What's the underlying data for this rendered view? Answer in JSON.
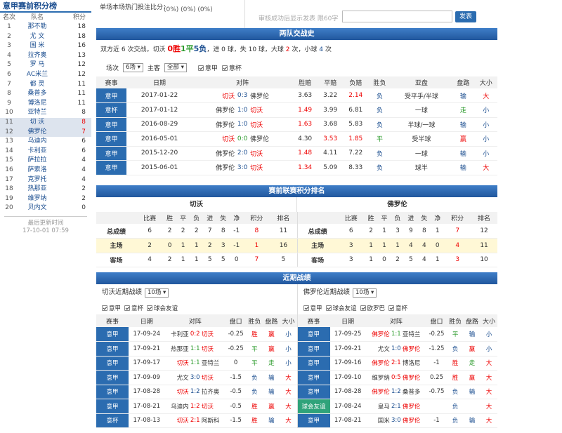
{
  "sidebar": {
    "title": "意甲赛前积分榜",
    "headers": [
      "名次",
      "队名",
      "积分"
    ],
    "rows": [
      {
        "rank": "1",
        "team": "那不勒",
        "pts": "18",
        "hl": false
      },
      {
        "rank": "2",
        "team": "尤 文",
        "pts": "18",
        "hl": false
      },
      {
        "rank": "3",
        "team": "国 米",
        "pts": "16",
        "hl": false
      },
      {
        "rank": "4",
        "team": "拉齐奥",
        "pts": "13",
        "hl": false
      },
      {
        "rank": "5",
        "team": "罗 马",
        "pts": "12",
        "hl": false
      },
      {
        "rank": "6",
        "team": "AC米兰",
        "pts": "12",
        "hl": false
      },
      {
        "rank": "7",
        "team": "都 灵",
        "pts": "11",
        "hl": false
      },
      {
        "rank": "8",
        "team": "桑普多",
        "pts": "11",
        "hl": false
      },
      {
        "rank": "9",
        "team": "博洛尼",
        "pts": "11",
        "hl": false
      },
      {
        "rank": "10",
        "team": "亚特兰",
        "pts": "8",
        "hl": false
      },
      {
        "rank": "11",
        "team": "切 沃",
        "pts": "8",
        "hl": true
      },
      {
        "rank": "12",
        "team": "佛罗伦",
        "pts": "7",
        "hl": true
      },
      {
        "rank": "13",
        "team": "乌迪内",
        "pts": "6",
        "hl": false
      },
      {
        "rank": "14",
        "team": "卡利亚",
        "pts": "6",
        "hl": false
      },
      {
        "rank": "15",
        "team": "萨拉拉",
        "pts": "4",
        "hl": false
      },
      {
        "rank": "16",
        "team": "萨索洛",
        "pts": "4",
        "hl": false
      },
      {
        "rank": "17",
        "team": "克罗托",
        "pts": "4",
        "hl": false
      },
      {
        "rank": "18",
        "team": "热那亚",
        "pts": "2",
        "hl": false
      },
      {
        "rank": "19",
        "team": "维罗纳",
        "pts": "2",
        "hl": false
      },
      {
        "rank": "20",
        "team": "贝内文",
        "pts": "0",
        "hl": false
      }
    ],
    "footer_label": "最后更新时间",
    "footer_time": "17-10-01 07:59"
  },
  "top": {
    "hot_label": "单场本场热门投注比分：",
    "hot_values": "(0%)  (0%)  (0%)",
    "post_hint": "审核成功后显示发表  限60字",
    "post_button": "发表"
  },
  "h2h": {
    "title": "两队交战史",
    "summary_pre": "双方近 6 次交战，切沃 ",
    "summary_w": "0胜",
    "summary_d": "1平",
    "summary_l": "5负",
    "summary_post": "，进 0 球，失 10 球，大球 ",
    "big": "2",
    "summary_mid": " 次，小球 ",
    "small": "4",
    "summary_end": " 次",
    "filter_label": "场次",
    "filter_value": "6场 ▾",
    "host_label": "主客",
    "host_value": "全部 ▾",
    "chk1": "意甲",
    "chk2": "意杯",
    "headers": [
      "赛事",
      "日期",
      "对阵",
      "胜赔",
      "平赔",
      "负赔",
      "胜负",
      "亚盘",
      "盘路",
      "大小"
    ],
    "rows": [
      {
        "league": "意甲",
        "date": "2017-01-22",
        "home": "切沃",
        "score": "0:3",
        "away": "佛罗伦",
        "w": "3.63",
        "d": "3.22",
        "l": "2.14",
        "res": "负",
        "handicap": "受平手/半球",
        "hr": "输",
        "ou": "大"
      },
      {
        "league": "意杯",
        "date": "2017-01-12",
        "home": "佛罗伦",
        "score": "1:0",
        "away": "切沃",
        "w": "1.49",
        "d": "3.99",
        "l": "6.81",
        "res": "负",
        "handicap": "一球",
        "hr": "走",
        "ou": "小"
      },
      {
        "league": "意甲",
        "date": "2016-08-29",
        "home": "佛罗伦",
        "score": "1:0",
        "away": "切沃",
        "w": "1.63",
        "d": "3.68",
        "l": "5.83",
        "res": "负",
        "handicap": "半球/一球",
        "hr": "输",
        "ou": "小"
      },
      {
        "league": "意甲",
        "date": "2016-05-01",
        "home": "切沃",
        "score": "0:0",
        "away": "佛罗伦",
        "w": "4.30",
        "d": "3.53",
        "l": "1.85",
        "res": "平",
        "handicap": "受半球",
        "hr": "赢",
        "ou": "小"
      },
      {
        "league": "意甲",
        "date": "2015-12-20",
        "home": "佛罗伦",
        "score": "2:0",
        "away": "切沃",
        "w": "1.48",
        "d": "4.11",
        "l": "7.22",
        "res": "负",
        "handicap": "一球",
        "hr": "输",
        "ou": "小"
      },
      {
        "league": "意甲",
        "date": "2015-06-01",
        "home": "佛罗伦",
        "score": "3:0",
        "away": "切沃",
        "w": "1.34",
        "d": "5.09",
        "l": "8.33",
        "res": "负",
        "handicap": "球半",
        "hr": "输",
        "ou": "大"
      }
    ]
  },
  "standings": {
    "title": "赛前联赛积分排名",
    "left_team": "切沃",
    "right_team": "佛罗伦",
    "headers": [
      "",
      "比赛",
      "胜",
      "平",
      "负",
      "进",
      "失",
      "净",
      "积分",
      "排名"
    ],
    "left_rows": [
      {
        "label": "总成绩",
        "v": [
          "6",
          "2",
          "2",
          "2",
          "7",
          "8",
          "-1",
          "8",
          "11"
        ]
      },
      {
        "label": "主场",
        "v": [
          "2",
          "0",
          "1",
          "1",
          "2",
          "3",
          "-1",
          "1",
          "16"
        ]
      },
      {
        "label": "客场",
        "v": [
          "4",
          "2",
          "1",
          "1",
          "5",
          "5",
          "0",
          "7",
          "5"
        ]
      }
    ],
    "right_rows": [
      {
        "label": "总成绩",
        "v": [
          "6",
          "2",
          "1",
          "3",
          "9",
          "8",
          "1",
          "7",
          "12"
        ]
      },
      {
        "label": "主场",
        "v": [
          "3",
          "1",
          "1",
          "1",
          "4",
          "4",
          "0",
          "4",
          "11"
        ]
      },
      {
        "label": "客场",
        "v": [
          "3",
          "1",
          "0",
          "2",
          "5",
          "4",
          "1",
          "3",
          "10"
        ]
      }
    ]
  },
  "recent": {
    "title": "近期战绩",
    "left": {
      "label": "切沃近期战绩",
      "count": "10场 ▾",
      "filters": [
        "意甲",
        "意杯",
        "球会友谊"
      ],
      "headers": [
        "赛事",
        "日期",
        "对阵",
        "盘口",
        "胜负",
        "盘路",
        "大小"
      ],
      "rows": [
        {
          "league": "意甲",
          "date": "17-09-24",
          "home": "卡利亚",
          "score": "0:2",
          "away": "切沃",
          "hc": "-0.25",
          "res": "胜",
          "hr": "赢",
          "ou": "小"
        },
        {
          "league": "意甲",
          "date": "17-09-21",
          "home": "热那亚",
          "score": "1:1",
          "away": "切沃",
          "hc": "-0.25",
          "res": "平",
          "hr": "赢",
          "ou": "小"
        },
        {
          "league": "意甲",
          "date": "17-09-17",
          "home": "切沃",
          "score": "1:1",
          "away": "亚特兰",
          "hc": "0",
          "res": "平",
          "hr": "走",
          "ou": "小"
        },
        {
          "league": "意甲",
          "date": "17-09-09",
          "home": "尤文",
          "score": "3:0",
          "away": "切沃",
          "hc": "-1.5",
          "res": "负",
          "hr": "输",
          "ou": "大"
        },
        {
          "league": "意甲",
          "date": "17-08-28",
          "home": "切沃",
          "score": "1:2",
          "away": "拉齐奥",
          "hc": "-0.5",
          "res": "负",
          "hr": "输",
          "ou": "大"
        },
        {
          "league": "意甲",
          "date": "17-08-21",
          "home": "乌迪内",
          "score": "1:2",
          "away": "切沃",
          "hc": "-0.5",
          "res": "胜",
          "hr": "赢",
          "ou": "大"
        },
        {
          "league": "意杯",
          "date": "17-08-13",
          "home": "切沃",
          "score": "2:1",
          "away": "阿斯科",
          "hc": "-1.5",
          "res": "胜",
          "hr": "输",
          "ou": "大"
        }
      ]
    },
    "right": {
      "label": "佛罗伦近期战绩",
      "count": "10场 ▾",
      "filters": [
        "意甲",
        "球会友谊",
        "欧罗巴",
        "意杯"
      ],
      "headers": [
        "赛事",
        "日期",
        "对阵",
        "盘口",
        "胜负",
        "盘路",
        "大小"
      ],
      "rows": [
        {
          "league": "意甲",
          "date": "17-09-25",
          "home": "佛罗伦",
          "score": "1:1",
          "away": "亚特兰",
          "hc": "-0.25",
          "res": "平",
          "hr": "输",
          "ou": "小"
        },
        {
          "league": "意甲",
          "date": "17-09-21",
          "home": "尤文",
          "score": "1:0",
          "away": "佛罗伦",
          "hc": "-1.25",
          "res": "负",
          "hr": "赢",
          "ou": "小"
        },
        {
          "league": "意甲",
          "date": "17-09-16",
          "home": "佛罗伦",
          "score": "2:1",
          "away": "博洛尼",
          "hc": "-1",
          "res": "胜",
          "hr": "走",
          "ou": "大"
        },
        {
          "league": "意甲",
          "date": "17-09-10",
          "home": "维罗纳",
          "score": "0:5",
          "away": "佛罗伦",
          "hc": "0.25",
          "res": "胜",
          "hr": "赢",
          "ou": "大"
        },
        {
          "league": "意甲",
          "date": "17-08-28",
          "home": "佛罗伦",
          "score": "1:2",
          "away": "桑普多",
          "hc": "-0.75",
          "res": "负",
          "hr": "输",
          "ou": "大"
        },
        {
          "league": "球会友谊",
          "date": "17-08-24",
          "home": "皇马",
          "score": "2:1",
          "away": "佛罗伦",
          "hc": "",
          "res": "负",
          "hr": "",
          "ou": "大"
        },
        {
          "league": "意甲",
          "date": "17-08-21",
          "home": "国米",
          "score": "3:0",
          "away": "佛罗伦",
          "hc": "-1",
          "res": "负",
          "hr": "输",
          "ou": "大"
        }
      ]
    }
  },
  "colors": {
    "accent": "#2b6cb0",
    "win": "#e00000",
    "draw": "#2a9a2a",
    "loss": "#1a4d8f",
    "highlight": "#fff8d6"
  }
}
